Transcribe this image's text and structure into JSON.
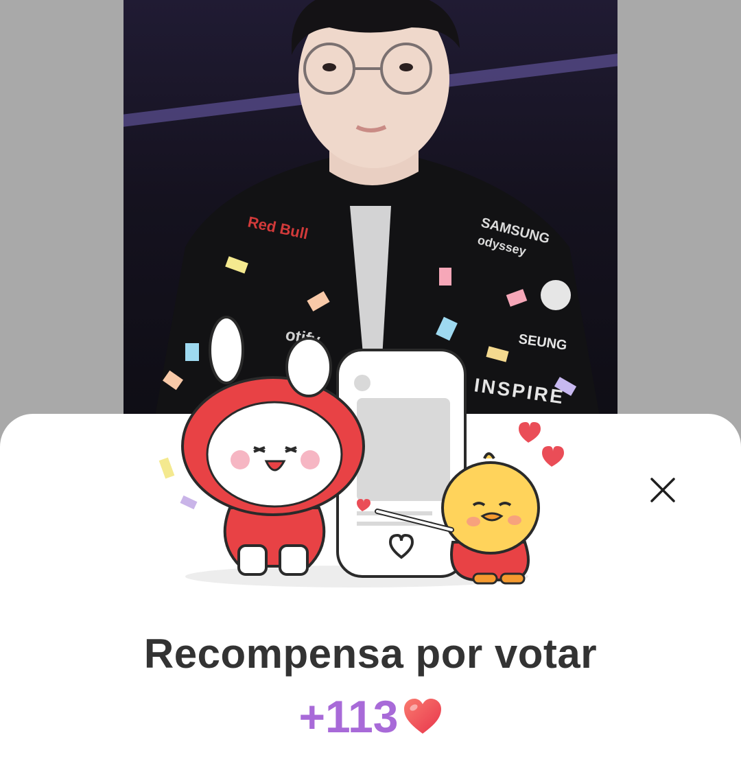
{
  "photo": {
    "shirt_texts": [
      "Red Bull",
      "SAMSUNG",
      "odyssey",
      "SEUNG",
      "INSPIRE",
      "otify"
    ]
  },
  "reward_sheet": {
    "title": "Recompensa por votar",
    "amount": "+113",
    "icons": {
      "close": "close-icon",
      "heart": "heart-icon"
    },
    "colors": {
      "amount": "#a86ad8",
      "title": "#333333",
      "heart": "#ea4d57"
    }
  }
}
